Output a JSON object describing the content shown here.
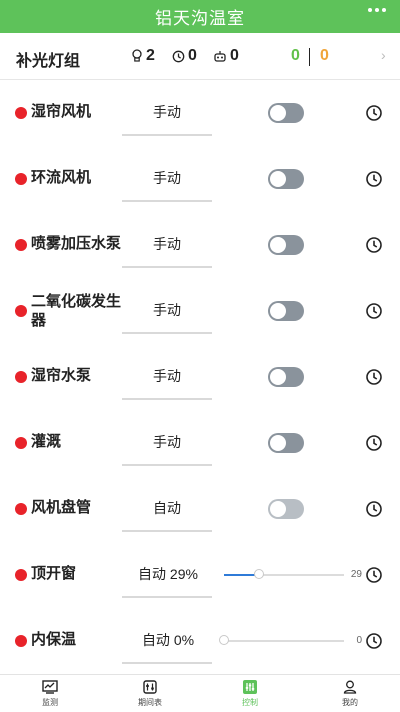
{
  "app": {
    "title": "铝天沟温室"
  },
  "group": {
    "title": "补光灯组",
    "stats": [
      {
        "icon": "bulb-icon",
        "value": "2"
      },
      {
        "icon": "clock-icon",
        "value": "0"
      },
      {
        "icon": "robot-icon",
        "value": "0"
      }
    ],
    "count_green": "0",
    "count_orange": "0"
  },
  "devices": [
    {
      "name": "湿帘风机",
      "mode": "手动",
      "control": "toggle",
      "on": false
    },
    {
      "name": "环流风机",
      "mode": "手动",
      "control": "toggle",
      "on": false
    },
    {
      "name": "喷雾加压水泵",
      "mode": "手动",
      "control": "toggle",
      "on": false
    },
    {
      "name": "二氧化碳发生器",
      "mode": "手动",
      "control": "toggle",
      "on": false
    },
    {
      "name": "湿帘水泵",
      "mode": "手动",
      "control": "toggle",
      "on": false
    },
    {
      "name": "灌溉",
      "mode": "手动",
      "control": "toggle",
      "on": false
    },
    {
      "name": "风机盘管",
      "mode": "自动",
      "control": "toggle",
      "on": false,
      "disabled": true
    },
    {
      "name": "顶开窗",
      "mode": "自动 29%",
      "control": "slider",
      "value": 29,
      "value_label": "29"
    },
    {
      "name": "内保温",
      "mode": "自动 0%",
      "control": "slider",
      "value": 0,
      "value_label": "0"
    }
  ],
  "tabs": [
    {
      "label": "监测",
      "icon": "monitor-icon"
    },
    {
      "label": "期间表",
      "icon": "schedule-icon"
    },
    {
      "label": "控制",
      "icon": "control-icon",
      "active": true
    },
    {
      "label": "我的",
      "icon": "user-icon"
    }
  ],
  "colors": {
    "brand": "#5ec25a",
    "status_dot": "#e8232a",
    "count_green": "#62c14a",
    "count_orange": "#f0a53a",
    "slider_fill": "#2f7bd8"
  }
}
